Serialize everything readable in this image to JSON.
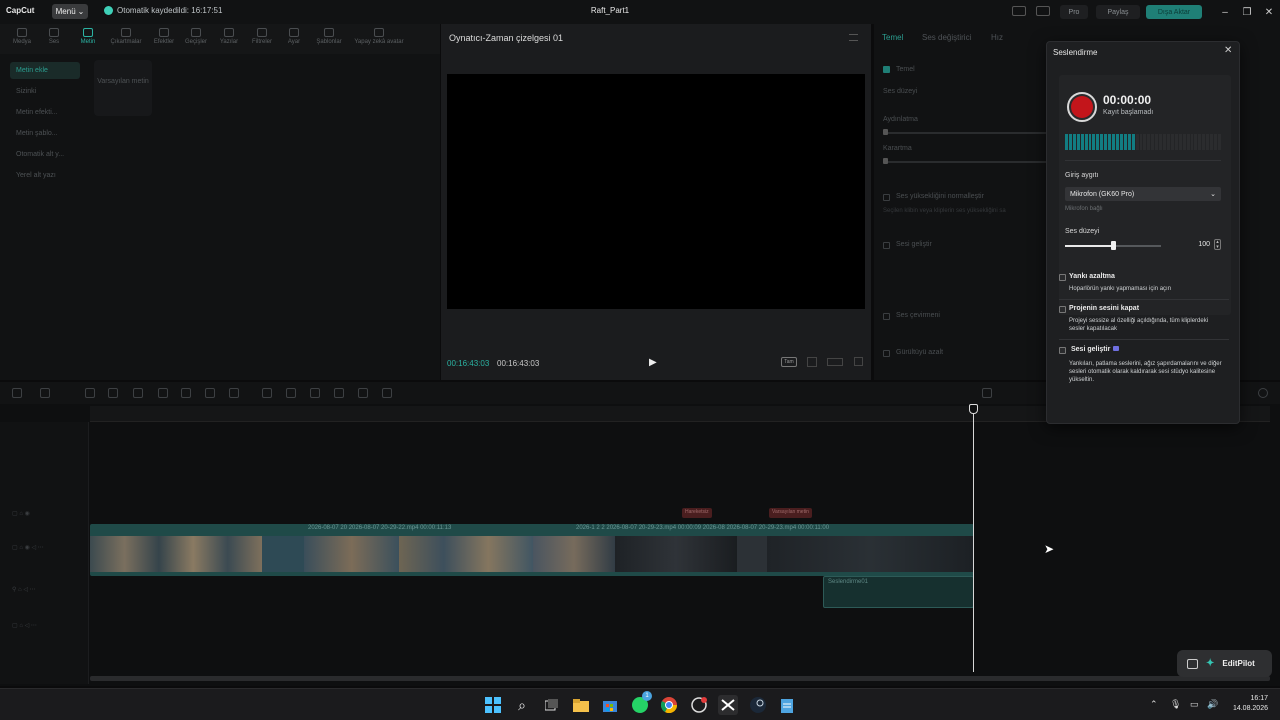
{
  "app": {
    "logo": "CapCut",
    "menu_label": "Menü",
    "autosave": "Otomatik kaydedildi: 16:17:51",
    "project_title": "Raft_Part1",
    "pro_label": "Pro",
    "share_label": "Paylaş",
    "export_label": "Dışa Aktar",
    "accent_color": "#2bb3a3"
  },
  "toolbar": {
    "items": [
      {
        "label": "Medya",
        "icon": "media-icon"
      },
      {
        "label": "Ses",
        "icon": "audio-icon"
      },
      {
        "label": "Metin",
        "icon": "text-icon",
        "active": true
      },
      {
        "label": "Çıkartmalar",
        "icon": "sticker-icon"
      },
      {
        "label": "Efektler",
        "icon": "effects-icon"
      },
      {
        "label": "Geçişler",
        "icon": "transitions-icon"
      },
      {
        "label": "Yazılar",
        "icon": "captions-icon"
      },
      {
        "label": "Filtreler",
        "icon": "filters-icon"
      },
      {
        "label": "Ayar",
        "icon": "adjust-icon"
      },
      {
        "label": "Şablonlar",
        "icon": "templates-icon"
      },
      {
        "label": "Yapay zekâ avatar",
        "icon": "ai-avatar-icon"
      }
    ]
  },
  "left_panel": {
    "categories": [
      {
        "label": "Metin ekle",
        "active": true
      },
      {
        "label": "Sizinki"
      },
      {
        "label": "Metin efekti..."
      },
      {
        "label": "Metin şablo..."
      },
      {
        "label": "Otomatik alt y..."
      },
      {
        "label": "Yerel alt yazı"
      }
    ],
    "default_card": "Varsayılan metin"
  },
  "player": {
    "title": "Oynatıcı-Zaman çizelgesi 01",
    "current_time": "00:16:43:03",
    "total_time": "00:16:43:03",
    "full_label": "Tam"
  },
  "right_panel": {
    "tabs": [
      "Temel",
      "Ses değiştirici",
      "Hız"
    ],
    "section_basic": "Temel",
    "volume_label": "Ses düzeyi",
    "fade_in_label": "Aydınlatma",
    "fade_out_label": "Karartma",
    "normalize_label": "Ses yüksekliğini normalleştir",
    "normalize_hint": "Seçilen klibin veya kliplerin ses yüksekliğini sa",
    "enhance_label": "Sesi geliştir",
    "voice_changer_label": "Ses çevirmeni",
    "denoise_label": "Gürültüyü azalt"
  },
  "timeline": {
    "clip_labels": "2026-08-07 20   2026-08-07 20-29-22.mp4   00:00:11:13",
    "clip_labels2": "2026-1  2  2   2026-08-07 20-29-23.mp4   00:00:09   2026-08   2026-08-07 20-29-23.mp4   00:00:11:00",
    "red_tag_1": "Hareketsiz",
    "red_tag_2": "Varsayılan metin",
    "audio_clip_label": "Seslendirme01"
  },
  "voiceover": {
    "title": "Seslendirme",
    "time": "00:00:00",
    "status": "Kayıt başlamadı",
    "meter_level": 0.45,
    "input_label": "Giriş aygıtı",
    "device": "Mikrofon (GK60 Pro)",
    "device_status": "Mikrofon bağlı",
    "volume_label": "Ses düzeyi",
    "volume_value": "100",
    "volume_fraction": 0.5,
    "echo_title": "Yankı azaltma",
    "echo_desc": "Hoparlörün yankı yapmaması için açın",
    "mute_title": "Projenin sesini kapat",
    "mute_desc": "Projeyi sessize al özelliği açıldığında, tüm kliplerdeki sesler kapatılacak",
    "enhance_title": "Sesi geliştir",
    "enhance_desc": "Yankıları, patlama seslerini, ağız şapırdamalarını ve diğer sesleri otomatik olarak kaldırarak sesi stüdyo kalitesine yükseltin."
  },
  "editpilot": {
    "label": "EditPilot"
  },
  "taskbar": {
    "time": "16:17",
    "date": "14.08.2026",
    "badge_count": "1"
  }
}
